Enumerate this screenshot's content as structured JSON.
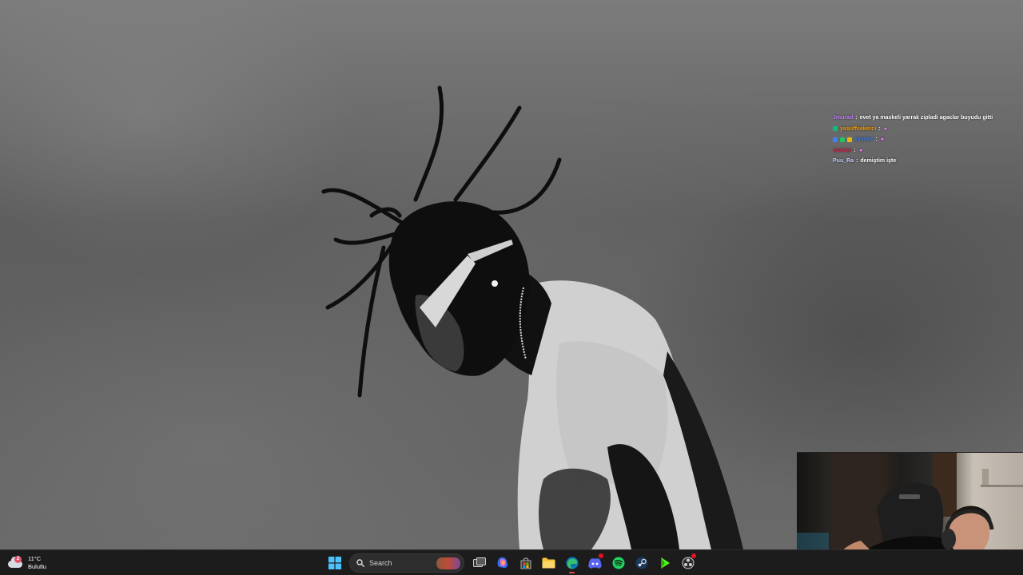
{
  "desktop": {
    "wallpaper_icon": "portrait-photo"
  },
  "chat": {
    "messages": [
      {
        "user": "Jmurad",
        "text": "evet ya maskeli yarrak zipladi agaclar buyudu gitti",
        "user_color": "#c084fc",
        "emote": ""
      },
      {
        "user": "yusuffsekerci",
        "text": "",
        "user_color": "#f59e0b",
        "emote": "sparkle-emote"
      },
      {
        "user": "xxxxxx",
        "text": "",
        "user_color": "#3b82f6",
        "emote": "sparkle-emote"
      },
      {
        "user": "xxxxxx",
        "text": "",
        "user_color": "#e11d48",
        "emote": "sparkle-emote"
      },
      {
        "user": "Puu_Ra",
        "text": "demiştim işte",
        "user_color": "#c7d2fe",
        "emote": ""
      }
    ]
  },
  "webcam": {
    "icon": "webcam-feed"
  },
  "taskbar": {
    "weather": {
      "temperature": "11°C",
      "condition": "Bulutlu",
      "alert_count": "2",
      "icon": "cloud-icon"
    },
    "search": {
      "label": "Search",
      "icon": "search-icon"
    },
    "apps": [
      {
        "name": "start",
        "icon": "windows-logo-icon"
      },
      {
        "name": "task-view",
        "icon": "task-view-icon"
      },
      {
        "name": "copilot",
        "icon": "copilot-icon"
      },
      {
        "name": "store",
        "icon": "store-icon"
      },
      {
        "name": "file-explorer",
        "icon": "folder-icon"
      },
      {
        "name": "edge",
        "icon": "edge-icon"
      },
      {
        "name": "discord",
        "icon": "discord-icon"
      },
      {
        "name": "spotify",
        "icon": "spotify-icon"
      },
      {
        "name": "steam",
        "icon": "steam-icon"
      },
      {
        "name": "green-app",
        "icon": "play-arrow-icon"
      },
      {
        "name": "obs",
        "icon": "obs-icon"
      }
    ],
    "accent_color": "#5c9bd6"
  }
}
